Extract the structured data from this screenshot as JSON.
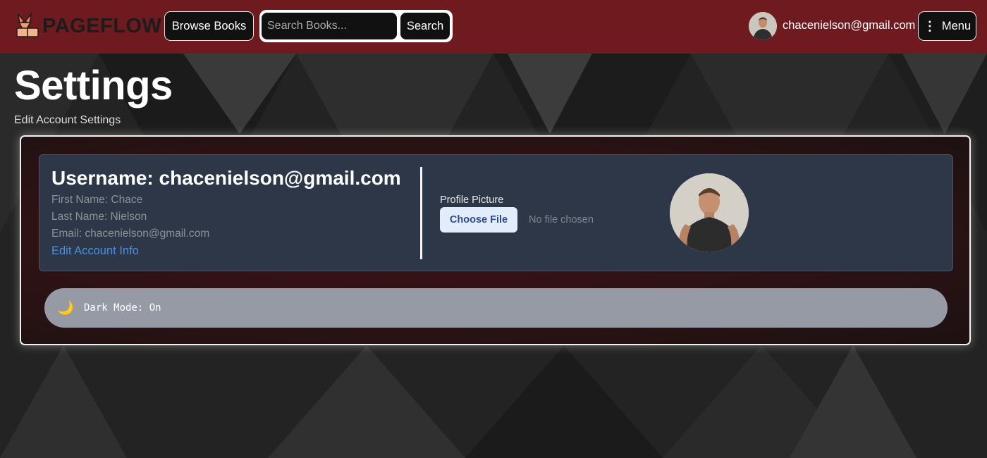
{
  "nav": {
    "brand": "PAGEFLOW",
    "browse_label": "Browse Books",
    "search_placeholder": "Search Books...",
    "search_label": "Search",
    "user_email": "chacenielson@gmail.com",
    "menu_label": "Menu",
    "menu_icon": "⋮"
  },
  "page": {
    "title": "Settings",
    "subtitle": "Edit Account Settings"
  },
  "account": {
    "username_line": "Username: chacenielson@gmail.com",
    "first_name_line": "First Name: Chace",
    "last_name_line": "Last Name: Nielson",
    "email_line": "Email: chacenielson@gmail.com",
    "edit_link": "Edit Account Info"
  },
  "profile_picture": {
    "label": "Profile Picture",
    "choose_label": "Choose File",
    "status": "No file chosen"
  },
  "dark_mode": {
    "icon": "🌙",
    "text": "Dark Mode: On"
  },
  "colors": {
    "navbar": "#6e1a1e",
    "panel": "#2d3748",
    "link": "#4a90e2",
    "toggle_bar": "#959aa5"
  }
}
